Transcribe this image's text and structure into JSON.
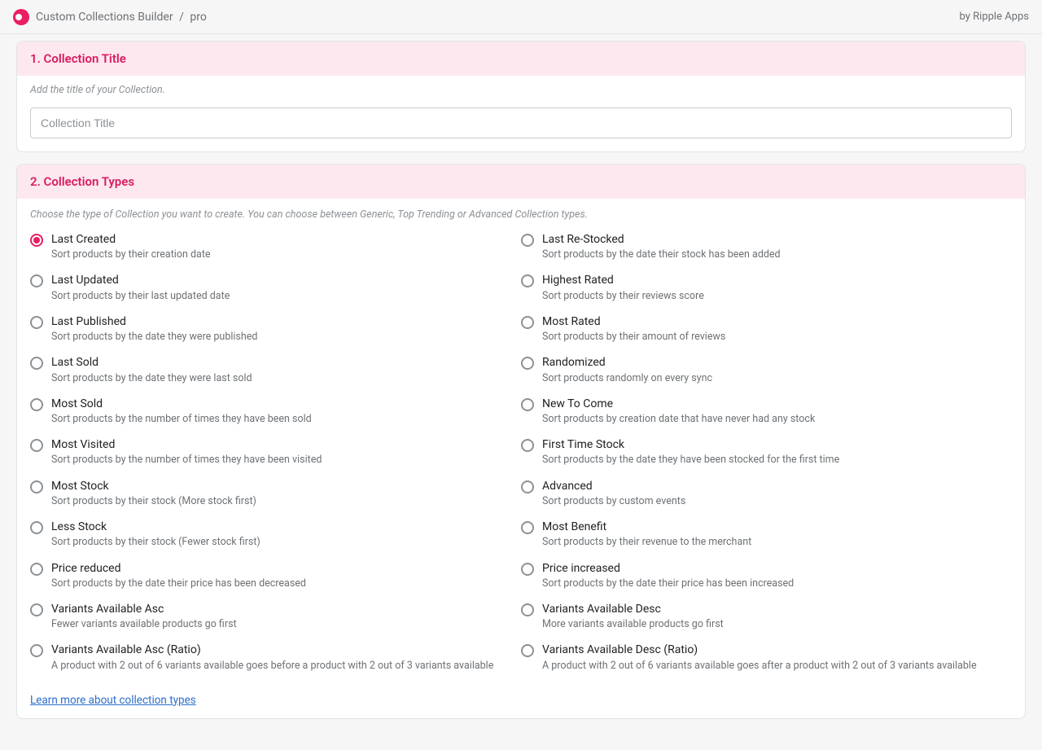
{
  "topbar": {
    "app_name": "Custom Collections Builder",
    "page": "pro",
    "by": "by Ripple Apps"
  },
  "section1": {
    "heading": "1. Collection Title",
    "hint": "Add the title of your Collection.",
    "placeholder": "Collection Title"
  },
  "section2": {
    "heading": "2. Collection Types",
    "hint": "Choose the type of Collection you want to create. You can choose between Generic, Top Trending or Advanced Collection types.",
    "link": "Learn more about collection types",
    "cols": {
      "left": [
        {
          "title": "Last Created",
          "desc": "Sort products by their creation date",
          "checked": true
        },
        {
          "title": "Last Updated",
          "desc": "Sort products by their last updated date",
          "checked": false
        },
        {
          "title": "Last Published",
          "desc": "Sort products by the date they were published",
          "checked": false
        },
        {
          "title": "Last Sold",
          "desc": "Sort products by the date they were last sold",
          "checked": false
        },
        {
          "title": "Most Sold",
          "desc": "Sort products by the number of times they have been sold",
          "checked": false
        },
        {
          "title": "Most Visited",
          "desc": "Sort products by the number of times they have been visited",
          "checked": false
        },
        {
          "title": "Most Stock",
          "desc": "Sort products by their stock (More stock first)",
          "checked": false
        },
        {
          "title": "Less Stock",
          "desc": "Sort products by their stock (Fewer stock first)",
          "checked": false
        },
        {
          "title": "Price reduced",
          "desc": "Sort products by the date their price has been decreased",
          "checked": false
        },
        {
          "title": "Variants Available Asc",
          "desc": "Fewer variants available products go first",
          "checked": false
        },
        {
          "title": "Variants Available Asc (Ratio)",
          "desc": "A product with 2 out of 6 variants available goes before a product with 2 out of 3 variants available",
          "checked": false
        }
      ],
      "right": [
        {
          "title": "Last Re-Stocked",
          "desc": "Sort products by the date their stock has been added",
          "checked": false
        },
        {
          "title": "Highest Rated",
          "desc": "Sort products by their reviews score",
          "checked": false
        },
        {
          "title": "Most Rated",
          "desc": "Sort products by their amount of reviews",
          "checked": false
        },
        {
          "title": "Randomized",
          "desc": "Sort products randomly on every sync",
          "checked": false
        },
        {
          "title": "New To Come",
          "desc": "Sort products by creation date that have never had any stock",
          "checked": false
        },
        {
          "title": "First Time Stock",
          "desc": "Sort products by the date they have been stocked for the first time",
          "checked": false
        },
        {
          "title": "Advanced",
          "desc": "Sort products by custom events",
          "checked": false
        },
        {
          "title": "Most Benefit",
          "desc": "Sort products by their revenue to the merchant",
          "checked": false
        },
        {
          "title": "Price increased",
          "desc": "Sort products by the date their price has been increased",
          "checked": false
        },
        {
          "title": "Variants Available Desc",
          "desc": "More variants available products go first",
          "checked": false
        },
        {
          "title": "Variants Available Desc (Ratio)",
          "desc": "A product with 2 out of 6 variants available goes after a product with 2 out of 3 variants available",
          "checked": false
        }
      ]
    }
  }
}
